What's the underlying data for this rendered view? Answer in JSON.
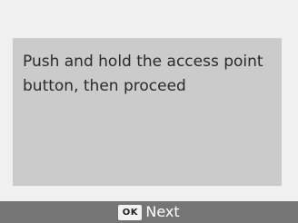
{
  "message": {
    "text": "Push and hold the access point button, then proceed"
  },
  "footer": {
    "ok_key_label": "OK",
    "next_label": "Next"
  },
  "colors": {
    "background": "#f0f0f0",
    "panel": "#cbcbcb",
    "footer_bar": "#757575",
    "text": "#2a2a2a"
  },
  "icons": {
    "ok_key": "ok-button-icon"
  }
}
